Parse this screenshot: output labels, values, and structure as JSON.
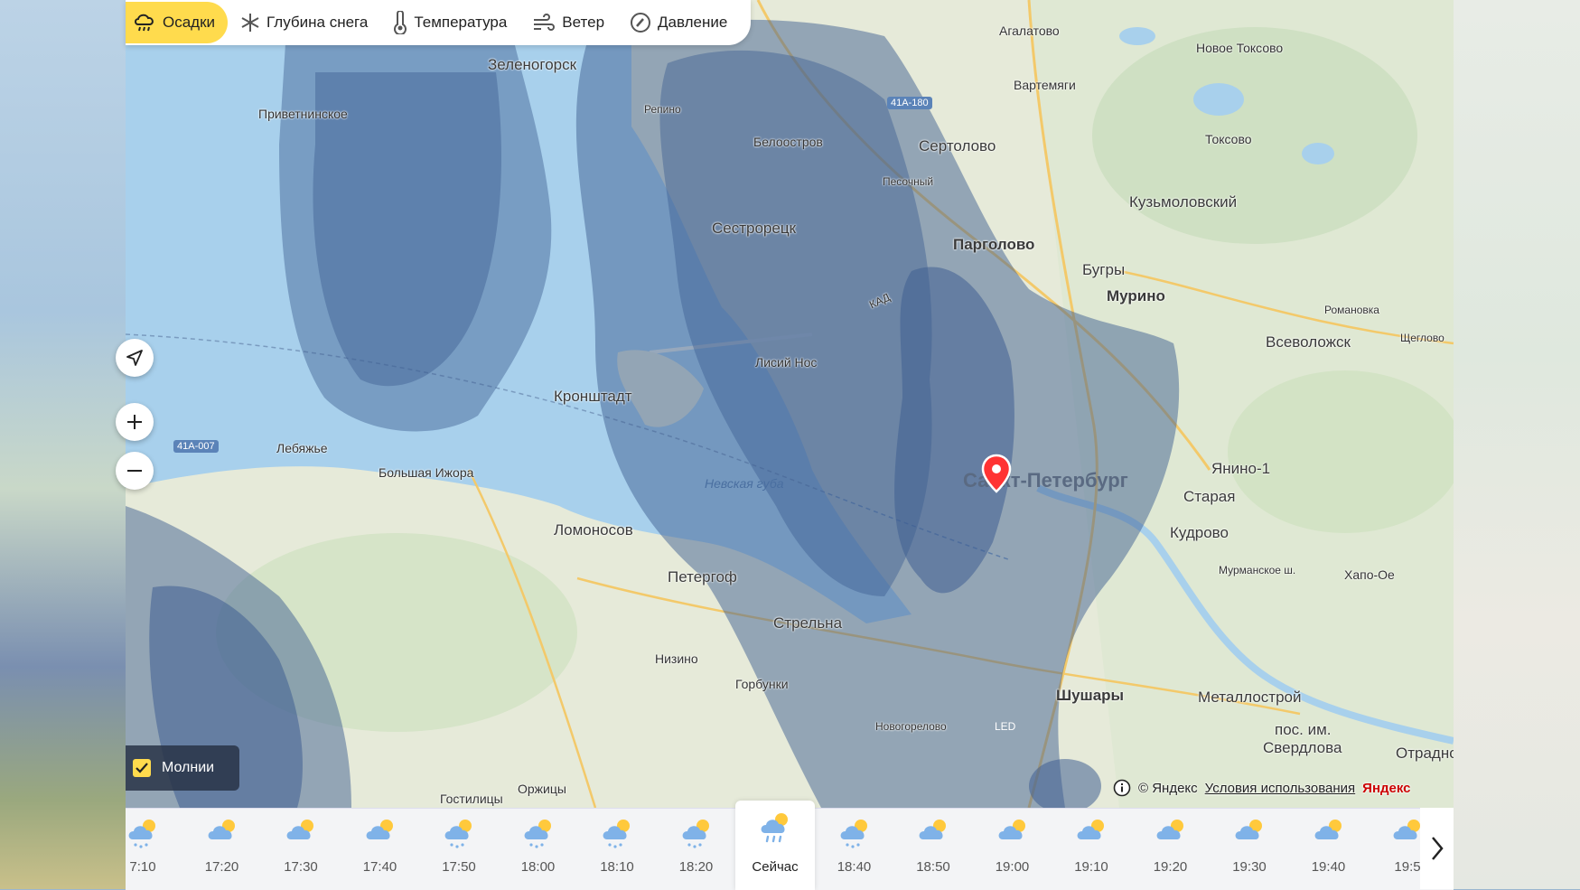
{
  "tabs": [
    {
      "label": "Осадки",
      "icon": "precipitation-icon",
      "active": true
    },
    {
      "label": "Глубина снега",
      "icon": "snowflake-icon",
      "active": false
    },
    {
      "label": "Температура",
      "icon": "thermometer-icon",
      "active": false
    },
    {
      "label": "Ветер",
      "icon": "wind-icon",
      "active": false
    },
    {
      "label": "Давление",
      "icon": "pressure-icon",
      "active": false
    }
  ],
  "map_labels": {
    "zelenogorsk": "Зеленогорск",
    "agalatovo": "Агалатово",
    "novoe_toksovo": "Новое Токсово",
    "vartemyagi": "Вартемяги",
    "privetninskoe": "Приветнинское",
    "repino": "Репино",
    "beloostrov": "Белоостров",
    "sertolovo": "Сертолово",
    "toksovo": "Токсово",
    "pesochny": "Песочный",
    "kuzmolovsky": "Кузьмоловский",
    "sestroretsk": "Сестрорецк",
    "pargolovo": "Парголово",
    "bugry": "Бугры",
    "murino": "Мурино",
    "romanovka": "Романовка",
    "vsevolozhsk": "Всеволожск",
    "shchoglovo": "Щеглово",
    "lisiy_nos": "Лисий Нос",
    "kronshtadt": "Кронштадт",
    "lebyazhe": "Лебяжье",
    "bolshaya_izhora": "Большая Ижора",
    "nevskaya_guba": "Невская губа",
    "spb": "Санкт-Петербург",
    "yanino": "Янино-1",
    "staraya": "Старая",
    "kudrovo": "Кудрово",
    "lomonosov": "Ломоносов",
    "peterhof": "Петергоф",
    "murmanskoe": "Мурманское ш.",
    "hapo_oe": "Хапо-Ое",
    "strelna": "Стрельна",
    "nizino": "Низино",
    "gorbunki": "Горбунки",
    "shushary": "Шушары",
    "metallostroy": "Металлострой",
    "novogorelovo": "Новогорелово",
    "led": "LED",
    "pos_sverdlova_1": "пос. им.",
    "pos_sverdlova_2": "Свердлова",
    "otradnoe": "Отрадное",
    "orzhitsy": "Оржицы",
    "gostilitsy": "Гостилицы",
    "kad": "КАД",
    "road_a": "41А-180",
    "road_b": "41А-007"
  },
  "lightning": {
    "label": "Молнии",
    "checked": true
  },
  "attribution": {
    "copyright": "© Яндекс",
    "terms": "Условия использования",
    "logo": "Яндекс"
  },
  "timeline": [
    {
      "time": "7:10",
      "icon": "cloud-snow-icon"
    },
    {
      "time": "17:20",
      "icon": "cloud-sun-icon"
    },
    {
      "time": "17:30",
      "icon": "cloud-sun-icon"
    },
    {
      "time": "17:40",
      "icon": "cloud-sun-icon"
    },
    {
      "time": "17:50",
      "icon": "cloud-snow-icon"
    },
    {
      "time": "18:00",
      "icon": "cloud-snow-icon"
    },
    {
      "time": "18:10",
      "icon": "cloud-snow-icon"
    },
    {
      "time": "18:20",
      "icon": "cloud-snow-icon"
    },
    {
      "time": "Сейчас",
      "icon": "cloud-rain-icon",
      "current": true
    },
    {
      "time": "18:40",
      "icon": "cloud-snow-icon"
    },
    {
      "time": "18:50",
      "icon": "cloud-sun-icon"
    },
    {
      "time": "19:00",
      "icon": "cloud-sun-icon"
    },
    {
      "time": "19:10",
      "icon": "cloud-sun-icon"
    },
    {
      "time": "19:20",
      "icon": "cloud-sun-icon"
    },
    {
      "time": "19:30",
      "icon": "cloud-sun-icon"
    },
    {
      "time": "19:40",
      "icon": "cloud-sun-icon"
    },
    {
      "time": "19:5",
      "icon": "cloud-sun-icon"
    }
  ]
}
